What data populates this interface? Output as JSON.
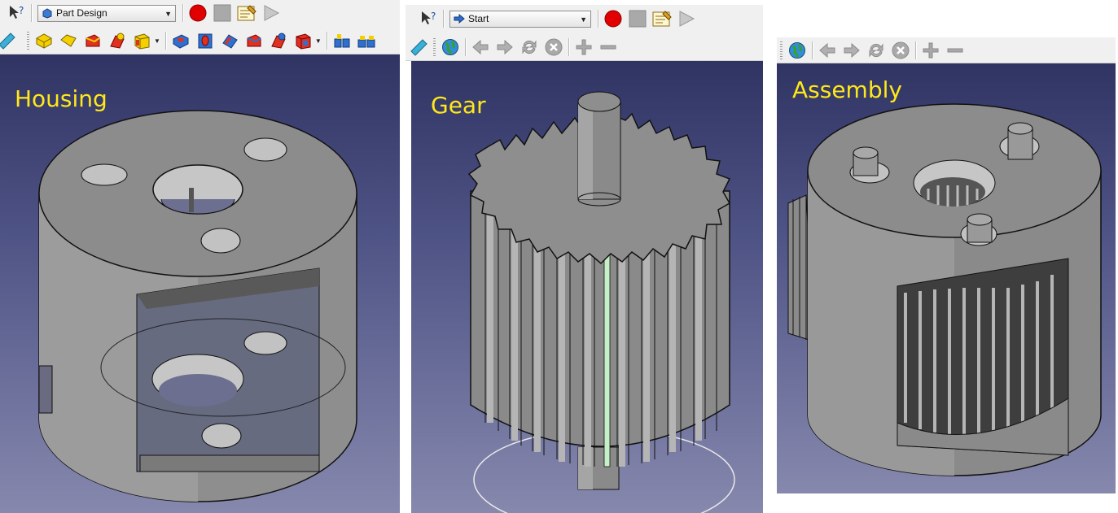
{
  "panels": [
    {
      "workbench_label": "Part Design",
      "viewport_label": "Housing"
    },
    {
      "workbench_label": "Start",
      "viewport_label": "Gear"
    },
    {
      "viewport_label": "Assembly"
    }
  ],
  "colors": {
    "label_text": "#ffe81a",
    "viewport_top": "#303463",
    "viewport_bottom": "#8688ad",
    "record": "#e00000"
  }
}
